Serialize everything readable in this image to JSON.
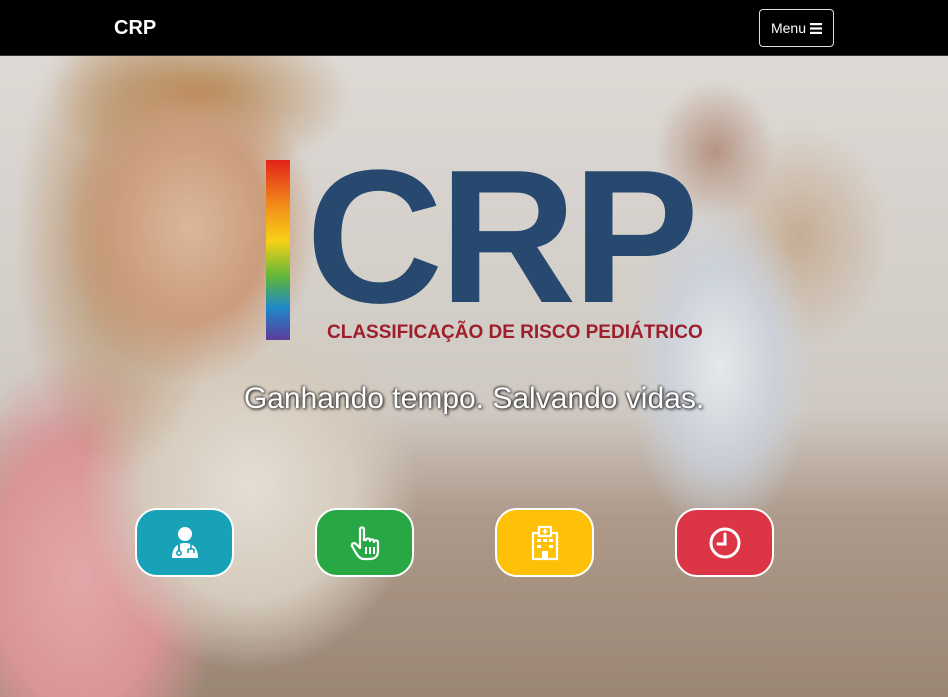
{
  "navbar": {
    "brand": "CRP",
    "menu_label": "Menu",
    "menu_icon": "bars-icon"
  },
  "hero": {
    "logo_text": "CRP",
    "logo_subtitle": "CLASSIFICAÇÃO DE RISCO PEDIÁTRICO",
    "tagline": "Ganhando tempo. Salvando vidas.",
    "buttons": [
      {
        "icon": "doctor-icon",
        "color": "#17a2b8"
      },
      {
        "icon": "hand-pointer-icon",
        "color": "#28a745"
      },
      {
        "icon": "hospital-icon",
        "color": "#ffc107"
      },
      {
        "icon": "clock-icon",
        "color": "#dc3545"
      }
    ]
  }
}
